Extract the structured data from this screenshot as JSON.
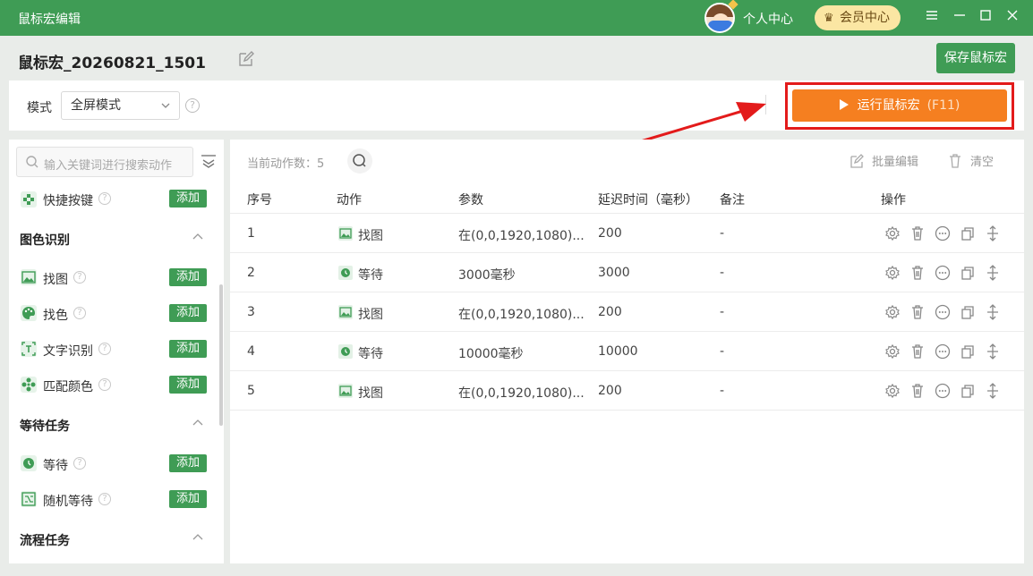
{
  "titlebar": {
    "title": "鼠标宏编辑",
    "user_center": "个人中心",
    "vip_label": "会员中心",
    "controls": [
      "menu-icon",
      "minimize-icon",
      "maximize-icon",
      "close-icon"
    ]
  },
  "header": {
    "macro_name": "鼠标宏_20260821_1501",
    "save_label": "保存鼠标宏"
  },
  "mode": {
    "label": "模式",
    "selected": "全屏模式",
    "help": "?"
  },
  "run": {
    "label": "运行鼠标宏",
    "hotkey": "(F11)"
  },
  "sidebar": {
    "search_placeholder": "输入关键词进行搜索动作",
    "add_label": "添加",
    "items": [
      {
        "label": "快捷按键",
        "icon": "shortcut-icon"
      },
      {
        "label": "找图",
        "icon": "image-icon"
      },
      {
        "label": "找色",
        "icon": "palette-icon"
      },
      {
        "label": "文字识别",
        "icon": "text-recognition-icon"
      },
      {
        "label": "匹配颜色",
        "icon": "color-match-icon"
      },
      {
        "label": "等待",
        "icon": "wait-icon"
      },
      {
        "label": "随机等待",
        "icon": "random-wait-icon"
      }
    ],
    "sections": [
      {
        "title": "图色识别"
      },
      {
        "title": "等待任务"
      },
      {
        "title": "流程任务"
      }
    ]
  },
  "table": {
    "count_label": "当前动作数：",
    "count": "5",
    "batch_edit": "批量编辑",
    "clear": "清空",
    "headers": [
      "序号",
      "动作",
      "参数",
      "延迟时间（毫秒）",
      "备注",
      "操作"
    ],
    "rows": [
      {
        "index": "1",
        "action": "找图",
        "action_icon": "image-icon",
        "param": "在(0,0,1920,1080)...",
        "delay": "200",
        "note": "-"
      },
      {
        "index": "2",
        "action": "等待",
        "action_icon": "wait-icon",
        "param": "3000毫秒",
        "delay": "3000",
        "note": "-"
      },
      {
        "index": "3",
        "action": "找图",
        "action_icon": "image-icon",
        "param": "在(0,0,1920,1080)...",
        "delay": "200",
        "note": "-"
      },
      {
        "index": "4",
        "action": "等待",
        "action_icon": "wait-icon",
        "param": "10000毫秒",
        "delay": "10000",
        "note": "-"
      },
      {
        "index": "5",
        "action": "找图",
        "action_icon": "image-icon",
        "param": "在(0,0,1920,1080)...",
        "delay": "200",
        "note": "-"
      }
    ],
    "row_operations": [
      "settings-icon",
      "delete-icon",
      "more-icon",
      "copy-icon",
      "move-icon"
    ]
  },
  "colors": {
    "brand_green": "#3f9c55",
    "run_orange": "#f57f20",
    "highlight_red": "#e31b1b",
    "vip_gold": "#fbe6a3"
  }
}
